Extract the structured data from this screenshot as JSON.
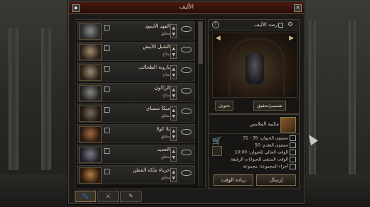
{
  "window": {
    "title": "الأليف"
  },
  "list": {
    "rows": [
      {
        "name": "الفهد الأسود",
        "state": "مغلق",
        "icon": "black-panther"
      },
      {
        "name": "الشبل الأبيض",
        "state": "متاح",
        "icon": "white-cub"
      },
      {
        "name": "بارونة الطحالب",
        "state": "متاح",
        "icon": "moss-baroness"
      },
      {
        "name": "الراكون",
        "state": "متاح",
        "icon": "raccoon"
      },
      {
        "name": "ميكا سمباي",
        "state": "مغلق",
        "icon": "mika"
      },
      {
        "name": "بلا كولا",
        "state": "مغلق",
        "icon": "creature"
      },
      {
        "name": "الحديد",
        "state": "مغلق",
        "icon": "iron"
      },
      {
        "name": "حرباء ملكة القطن",
        "state": "مغلق",
        "icon": "chameleon"
      }
    ]
  },
  "tabs": [
    "🐾",
    "⚔",
    "✎"
  ],
  "detail": {
    "title": "رصد الأليف",
    "help": "?",
    "arrow_left": "◀",
    "arrow_right": "▶",
    "customize_label": "تقسيم/تحقيق",
    "change_label": "تحويل"
  },
  "info": {
    "pet_label": "مكتبة الملابس",
    "cart_icon": "🛒",
    "stats": [
      "مستوى الحيوان: 35 - 31",
      "مستوى التقدم: 50",
      "الوقت الحالي للحيوان: 10:00",
      "الوقت المتبقي للحيوانات الرفيقة",
      "أجزاء المجموعة: مجموعة"
    ],
    "btn_left": "إرسال",
    "btn_right": "زيادة الوقت"
  }
}
